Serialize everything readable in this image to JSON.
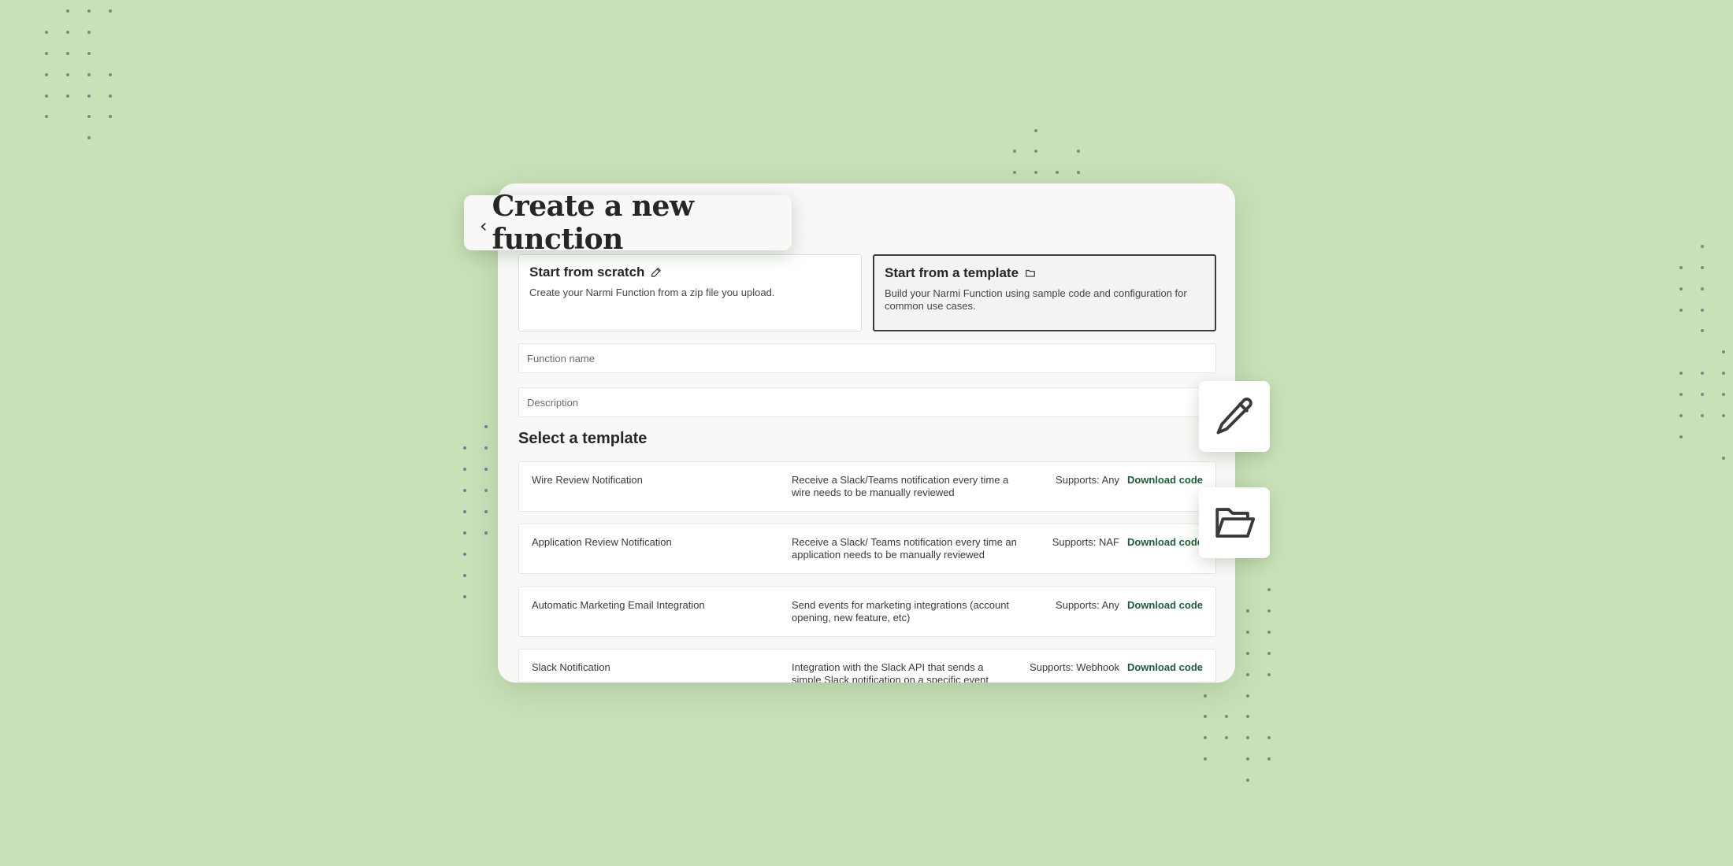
{
  "header": {
    "back_icon": "chevron-left-icon",
    "title": "Create a new function"
  },
  "options": [
    {
      "label": "Start from scratch",
      "icon": "pencil-icon",
      "description": "Create your Narmi Function from a zip file you upload.",
      "selected": false
    },
    {
      "label": "Start from a template",
      "icon": "folder-icon",
      "description": "Build your Narmi Function using sample code and configuration for common use cases.",
      "selected": true
    }
  ],
  "form": {
    "function_name_placeholder": "Function name",
    "description_placeholder": "Description"
  },
  "templates": {
    "title": "Select a template",
    "rows": [
      {
        "name": "Wire Review Notification",
        "description": "Receive a Slack/Teams notification every time a wire needs to be manually reviewed",
        "supports": "Supports: Any",
        "action": "Download code"
      },
      {
        "name": "Application Review Notification",
        "description": "Receive a Slack/ Teams notification every time an application needs to be manually reviewed",
        "supports": "Supports: NAF",
        "action": "Download code"
      },
      {
        "name": "Automatic Marketing Email Integration",
        "description": "Send events for marketing integrations (account opening, new feature, etc)",
        "supports": "Supports: Any",
        "action": "Download code"
      },
      {
        "name": "Slack Notification",
        "description": "Integration with the Slack API that sends a simple Slack notification on a specific event",
        "supports": "Supports: Webhook",
        "action": "Download code"
      }
    ]
  },
  "floating_tiles": [
    {
      "icon": "pencil-icon"
    },
    {
      "icon": "open-folder-icon"
    }
  ],
  "colors": {
    "background": "#c9e1b8",
    "accent_link": "#1f5a3a",
    "card": "#f8f8f7"
  }
}
